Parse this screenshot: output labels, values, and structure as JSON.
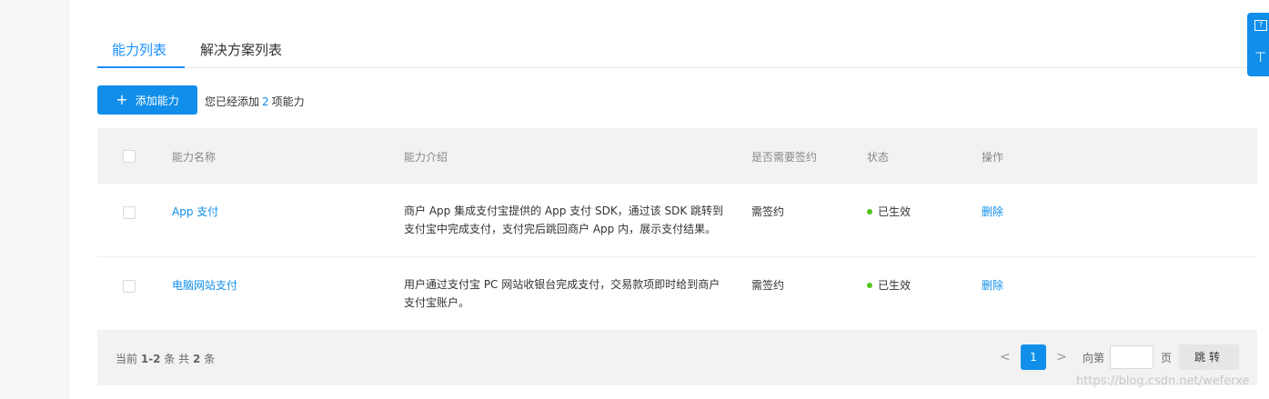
{
  "tabs": [
    {
      "label": "能力列表",
      "active": true
    },
    {
      "label": "解决方案列表",
      "active": false
    }
  ],
  "toolbar": {
    "add_label": "添加能力",
    "added_prefix": "您已经添加",
    "added_count": "2",
    "added_suffix": "项能力"
  },
  "table": {
    "headers": {
      "name": "能力名称",
      "intro": "能力介绍",
      "contract": "是否需要签约",
      "status": "状态",
      "action": "操作"
    },
    "rows": [
      {
        "name": "App 支付",
        "intro_line1": "商户 App 集成支付宝提供的 App 支付 SDK，通过该 SDK 跳转到",
        "intro_line2": "支付宝中完成支付，支付完后跳回商户 App 内，展示支付结果。",
        "contract": "需签约",
        "status": "已生效",
        "action": "删除"
      },
      {
        "name": "电脑网站支付",
        "intro_line1": "用户通过支付宝 PC 网站收银台完成支付，交易款项即时给到商户",
        "intro_line2": "支付宝账户。",
        "contract": "需签约",
        "status": "已生效",
        "action": "删除"
      }
    ]
  },
  "footer": {
    "range_prefix": "当前",
    "range": "1-2",
    "range_mid": "条 共",
    "total": "2",
    "range_suffix": "条"
  },
  "pagination": {
    "prev": "<",
    "current": "1",
    "next": ">",
    "goto_label": "向第",
    "goto_value": "",
    "goto_suffix": "页",
    "jump_label": "跳转"
  },
  "watermark": "https://blog.csdn.net/weferxe",
  "colors": {
    "accent": "#108ee9",
    "status_ok": "#52c41a",
    "header_bg": "#f2f2f2"
  },
  "icons": {
    "add": "plus-icon",
    "help": "question-icon",
    "float": "arrow-down-icon"
  }
}
